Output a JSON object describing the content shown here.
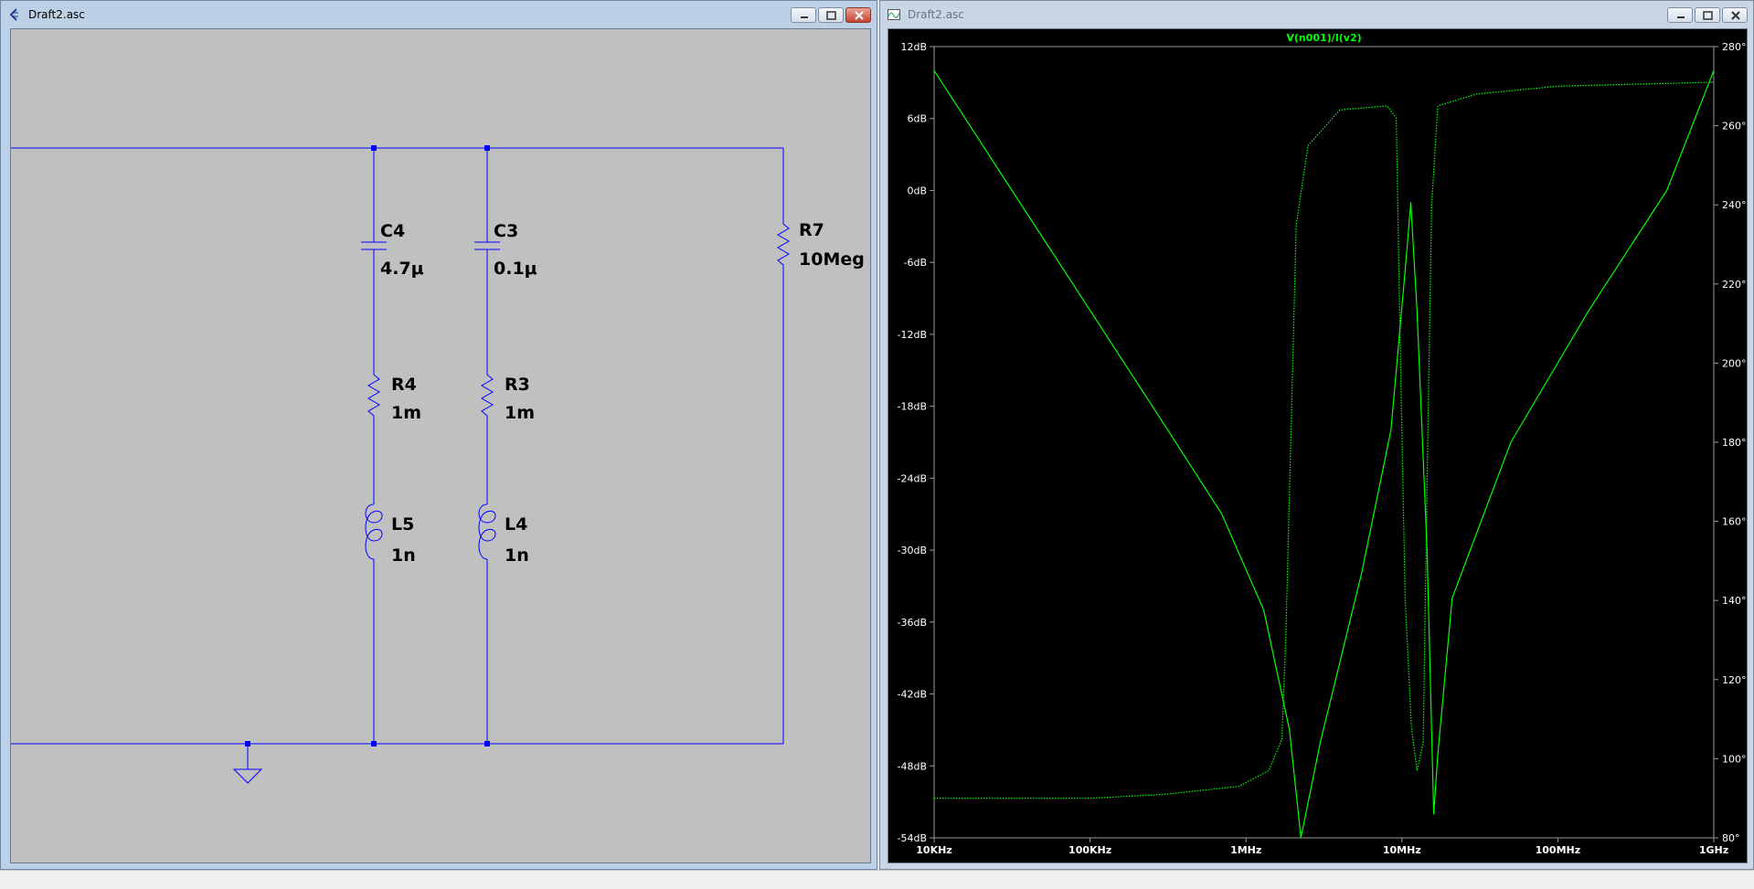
{
  "schematic_window": {
    "title": "Draft2.asc",
    "components": [
      {
        "ref": "C4",
        "value": "4.7μ"
      },
      {
        "ref": "C3",
        "value": "0.1μ"
      },
      {
        "ref": "R7",
        "value": "10Meg"
      },
      {
        "ref": "R4",
        "value": "1m"
      },
      {
        "ref": "R3",
        "value": "1m"
      },
      {
        "ref": "L5",
        "value": "1n"
      },
      {
        "ref": "L4",
        "value": "1n"
      }
    ]
  },
  "plot_window": {
    "title": "Draft2.asc"
  },
  "colors": {
    "schematic_bg": "#c0c0c0",
    "wire": "#0000ff",
    "plot_bg": "#000000",
    "trace": "#00ff00",
    "axis_text": "#ffffff"
  },
  "chart_data": {
    "type": "line",
    "title": "V(n001)/I(v2)",
    "xscale": "log",
    "xlim": [
      10000,
      1000000000
    ],
    "x_ticks": [
      "10KHz",
      "100KHz",
      "1MHz",
      "10MHz",
      "100MHz",
      "1GHz"
    ],
    "ylim": [
      -54,
      12
    ],
    "y_ticks_left": [
      "12dB",
      "6dB",
      "0dB",
      "-6dB",
      "-12dB",
      "-18dB",
      "-24dB",
      "-30dB",
      "-36dB",
      "-42dB",
      "-48dB",
      "-54dB"
    ],
    "y2lim": [
      80,
      280
    ],
    "y_ticks_right": [
      "280°",
      "260°",
      "240°",
      "220°",
      "200°",
      "180°",
      "160°",
      "140°",
      "120°",
      "100°",
      "80°"
    ],
    "series": [
      {
        "style": "solid",
        "axis": "left",
        "points": [
          [
            10000,
            10
          ],
          [
            31600,
            0
          ],
          [
            100000,
            -10
          ],
          [
            316000,
            -20
          ],
          [
            700000,
            -27
          ],
          [
            1300000,
            -35
          ],
          [
            1900000,
            -45
          ],
          [
            2250000,
            -54
          ],
          [
            3000000,
            -46
          ],
          [
            5500000,
            -32
          ],
          [
            8500000,
            -20
          ],
          [
            10600000,
            -6
          ],
          [
            11400000,
            -1
          ],
          [
            12500000,
            -10
          ],
          [
            14500000,
            -30
          ],
          [
            16000000,
            -52
          ],
          [
            17000000,
            -47
          ],
          [
            21000000,
            -34
          ],
          [
            50000000,
            -21
          ],
          [
            158000000,
            -10
          ],
          [
            500000000,
            0
          ],
          [
            1000000000,
            10
          ]
        ]
      },
      {
        "style": "dotted",
        "axis": "right",
        "points": [
          [
            10000,
            90
          ],
          [
            100000,
            90
          ],
          [
            300000,
            91
          ],
          [
            900000,
            93
          ],
          [
            1400000,
            97
          ],
          [
            1700000,
            105
          ],
          [
            1800000,
            130
          ],
          [
            2100000,
            235
          ],
          [
            2500000,
            255
          ],
          [
            4000000,
            264
          ],
          [
            8000000,
            265
          ],
          [
            9200000,
            262
          ],
          [
            9800000,
            200
          ],
          [
            10500000,
            140
          ],
          [
            11500000,
            108
          ],
          [
            12500000,
            97
          ],
          [
            13700000,
            104
          ],
          [
            14500000,
            170
          ],
          [
            15500000,
            240
          ],
          [
            17000000,
            265
          ],
          [
            30000000,
            268
          ],
          [
            100000000,
            270
          ],
          [
            1000000000,
            271
          ]
        ]
      }
    ]
  }
}
